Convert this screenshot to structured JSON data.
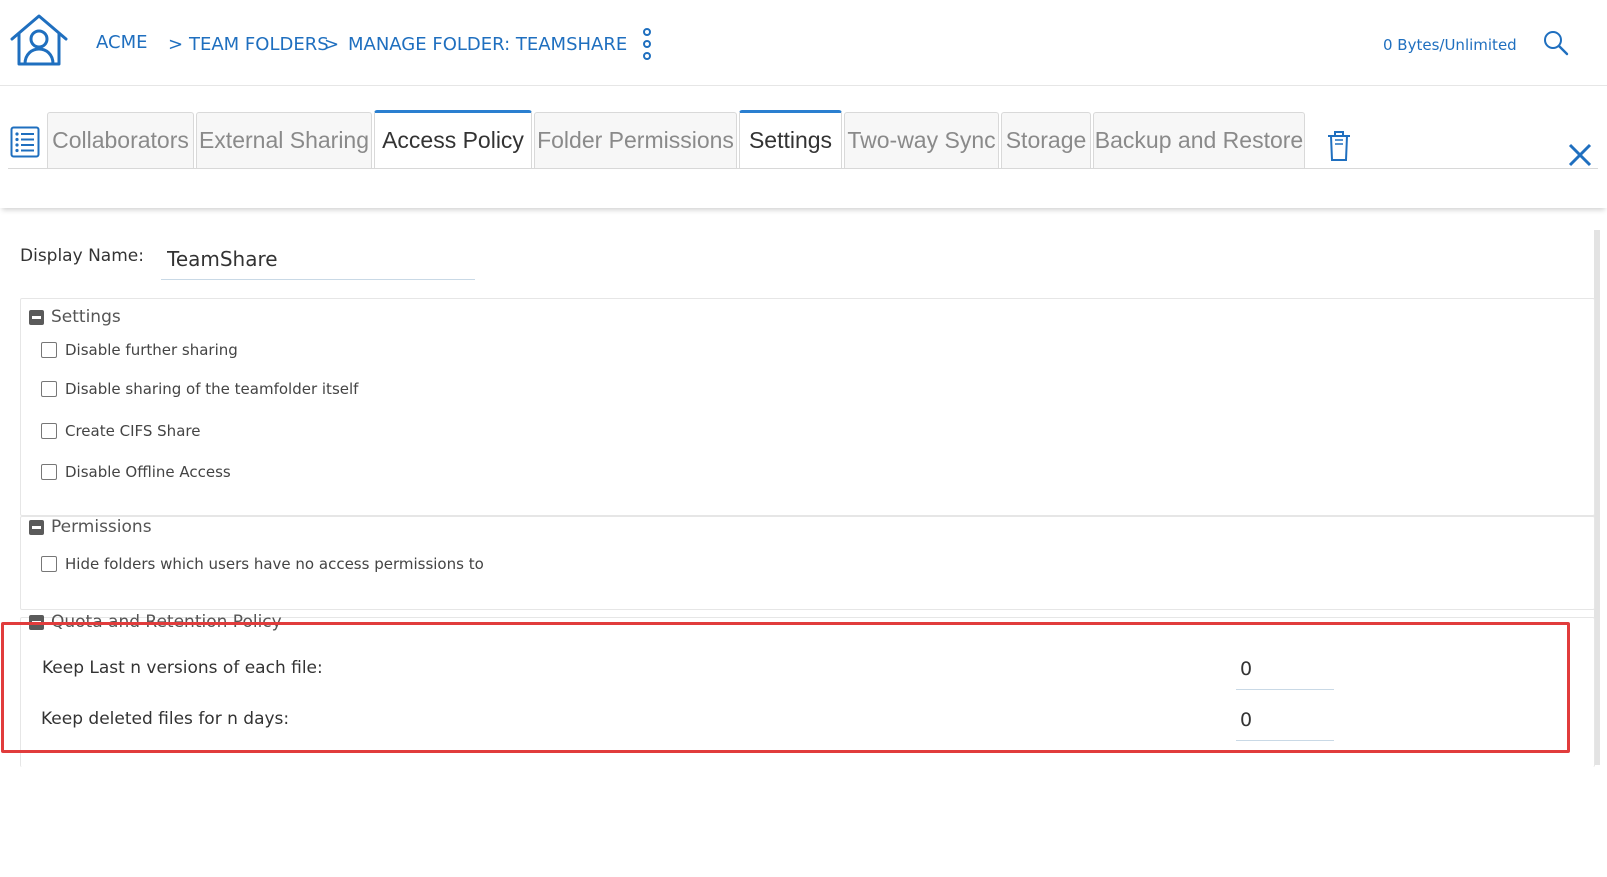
{
  "header": {
    "breadcrumb": {
      "root": "ACME",
      "separator": ">",
      "team_folders": "TEAM FOLDERS",
      "manage_folder": "MANAGE FOLDER: TEAMSHARE"
    },
    "quota_text": "0 Bytes/Unlimited",
    "icons": {
      "home": "home-user-icon",
      "menu": "kebab-menu-icon",
      "search": "search-icon"
    }
  },
  "tabs": [
    {
      "label": "Collaborators",
      "active": false
    },
    {
      "label": "External Sharing",
      "active": false
    },
    {
      "label": "Access Policy",
      "active": true
    },
    {
      "label": "Folder Permissions",
      "active": false
    },
    {
      "label": "Settings",
      "active": true
    },
    {
      "label": "Two-way Sync",
      "active": false
    },
    {
      "label": "Storage",
      "active": false
    },
    {
      "label": "Backup and Restore",
      "active": false
    }
  ],
  "tab_icons": {
    "list": "list-icon",
    "delete": "trash-icon",
    "close": "close-icon"
  },
  "form": {
    "display_name_label": "Display Name:",
    "display_name_value": "TeamShare",
    "sections": {
      "settings": {
        "title": "Settings",
        "options": [
          {
            "label": "Disable further sharing",
            "checked": false
          },
          {
            "label": "Disable sharing of the teamfolder itself",
            "checked": false
          },
          {
            "label": "Create CIFS Share",
            "checked": false
          },
          {
            "label": "Disable Offline Access",
            "checked": false
          }
        ]
      },
      "permissions": {
        "title": "Permissions",
        "options": [
          {
            "label": "Hide folders which users have no access permissions to",
            "checked": false
          }
        ]
      },
      "quota": {
        "title": "Quota and Retention Policy",
        "keep_versions_label": "Keep Last n versions of each file:",
        "keep_versions_value": "0",
        "keep_deleted_label": "Keep deleted files for n days:",
        "keep_deleted_value": "0"
      }
    }
  },
  "colors": {
    "accent": "#1f6fbf",
    "active_tab_border": "#2a7fd0",
    "highlight": "#e13c3c"
  }
}
